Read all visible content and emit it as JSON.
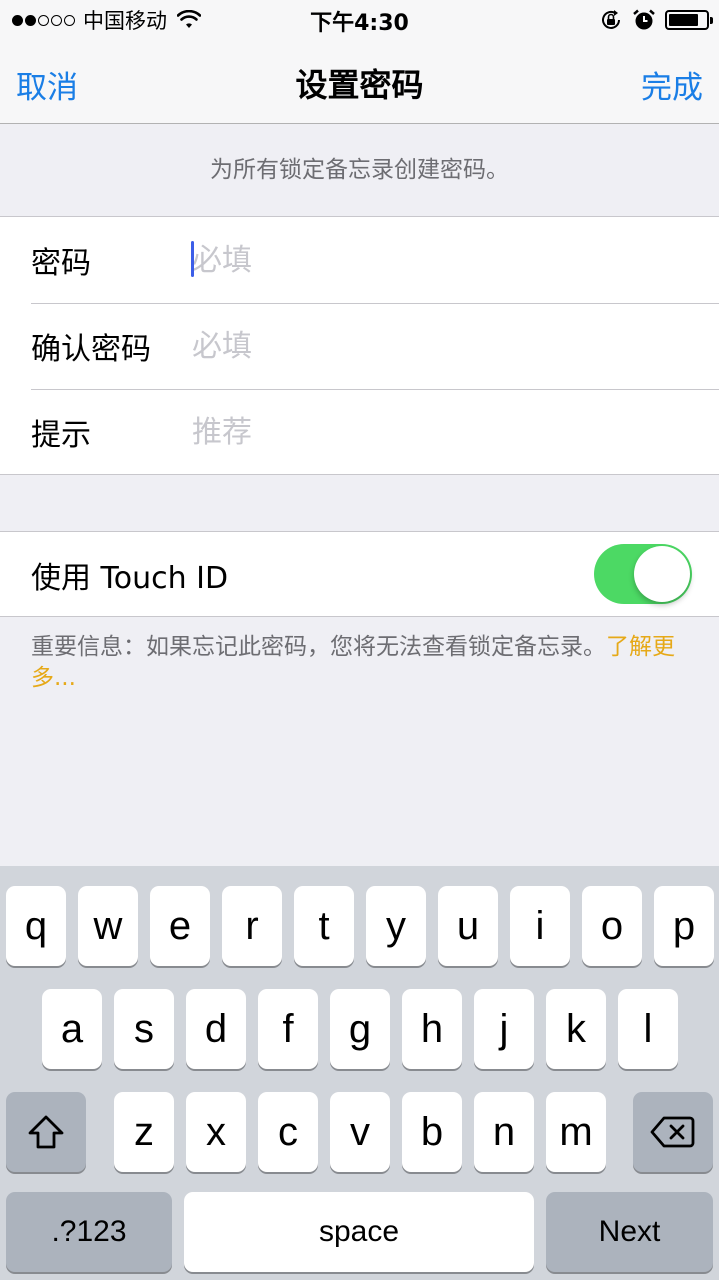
{
  "status_bar": {
    "signal_filled": 2,
    "signal_total": 5,
    "carrier": "中国移动",
    "time": "下午4:30",
    "icons": [
      "wifi-icon",
      "rotation-lock-icon",
      "alarm-icon",
      "battery-icon"
    ],
    "battery_level": 0.8
  },
  "nav": {
    "cancel_label": "取消",
    "title": "设置密码",
    "done_label": "完成",
    "accent_color": "#1a7ee6"
  },
  "section_header": "为所有锁定备忘录创建密码。",
  "form": {
    "rows": [
      {
        "label": "密码",
        "value": "",
        "placeholder": "必填"
      },
      {
        "label": "确认密码",
        "value": "",
        "placeholder": "必填"
      },
      {
        "label": "提示",
        "value": "",
        "placeholder": "推荐"
      }
    ]
  },
  "touch_id": {
    "label": "使用 Touch ID",
    "enabled": true,
    "on_color": "#4cd964"
  },
  "footer": {
    "note": "重要信息：如果忘记此密码，您将无法查看锁定备忘录。",
    "link": "了解更多...",
    "link_color": "#e6a918"
  },
  "keyboard": {
    "row1": [
      "q",
      "w",
      "e",
      "r",
      "t",
      "y",
      "u",
      "i",
      "o",
      "p"
    ],
    "row2": [
      "a",
      "s",
      "d",
      "f",
      "g",
      "h",
      "j",
      "k",
      "l"
    ],
    "row3": [
      "z",
      "x",
      "c",
      "v",
      "b",
      "n",
      "m"
    ],
    "numbers_label": ".?123",
    "space_label": "space",
    "return_label": "Next"
  }
}
